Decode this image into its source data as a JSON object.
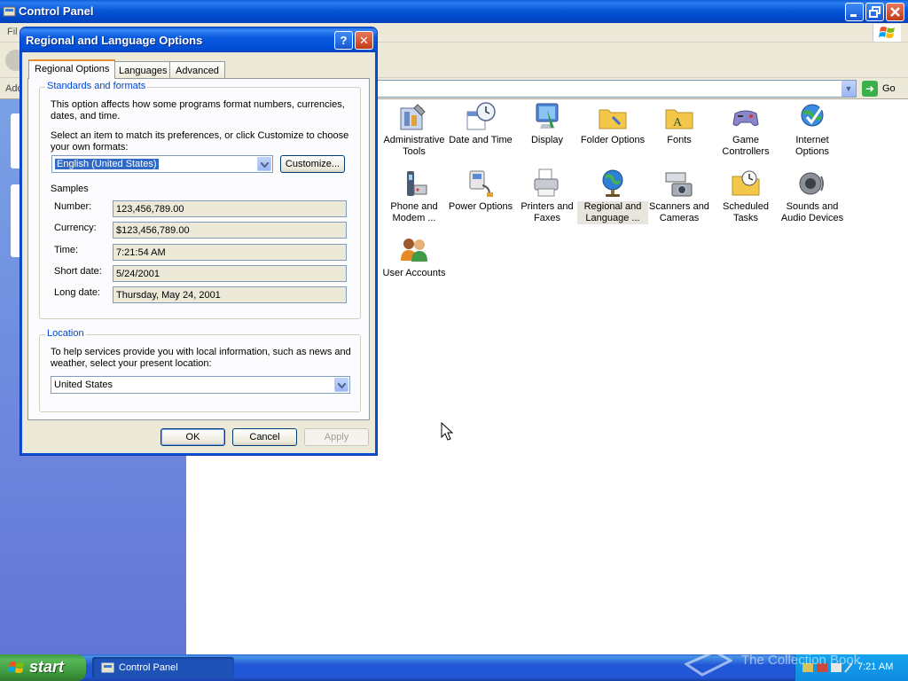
{
  "cp_window": {
    "title": "Control Panel",
    "menu_file": "Fil",
    "address_label": "Add",
    "go_label": "Go",
    "items": [
      {
        "id": "administrative-tools",
        "label": "Administrative Tools",
        "icon": "admin-tools-icon"
      },
      {
        "id": "date-and-time",
        "label": "Date and Time",
        "icon": "clock-calendar-icon"
      },
      {
        "id": "display",
        "label": "Display",
        "icon": "monitor-icon"
      },
      {
        "id": "folder-options",
        "label": "Folder Options",
        "icon": "folder-icon"
      },
      {
        "id": "fonts",
        "label": "Fonts",
        "icon": "fonts-folder-icon"
      },
      {
        "id": "game-controllers",
        "label": "Game Controllers",
        "icon": "gamepad-icon"
      },
      {
        "id": "internet-options",
        "label": "Internet Options",
        "icon": "globe-check-icon"
      },
      {
        "id": "phone-and-modem",
        "label": "Phone and Modem ...",
        "icon": "phone-icon"
      },
      {
        "id": "power-options",
        "label": "Power Options",
        "icon": "power-plug-icon"
      },
      {
        "id": "printers-and-faxes",
        "label": "Printers and Faxes",
        "icon": "printer-icon"
      },
      {
        "id": "regional-and-language",
        "label": "Regional and Language ...",
        "icon": "globe-icon",
        "selected": true
      },
      {
        "id": "scanners-and-cameras",
        "label": "Scanners and Cameras",
        "icon": "scanner-camera-icon"
      },
      {
        "id": "scheduled-tasks",
        "label": "Scheduled Tasks",
        "icon": "scheduled-folder-icon"
      },
      {
        "id": "sounds-and-audio",
        "label": "Sounds and Audio Devices",
        "icon": "speaker-icon"
      },
      {
        "id": "user-accounts",
        "label": "User Accounts",
        "icon": "users-icon"
      }
    ]
  },
  "dialog": {
    "title": "Regional and Language Options",
    "help_glyph": "?",
    "close_glyph": "✕",
    "tabs": [
      {
        "label": "Regional Options",
        "active": true
      },
      {
        "label": "Languages"
      },
      {
        "label": "Advanced"
      }
    ],
    "standards": {
      "legend": "Standards and formats",
      "desc": "This option affects how some programs format numbers, currencies, dates, and time.",
      "select_text": "Select an item to match its preferences, or click Customize to choose your own formats:",
      "format_value": "English (United States)",
      "customize_label": "Customize...",
      "samples_label": "Samples",
      "samples": [
        {
          "label": "Number:",
          "value": "123,456,789.00"
        },
        {
          "label": "Currency:",
          "value": "$123,456,789.00"
        },
        {
          "label": "Time:",
          "value": "7:21:54 AM"
        },
        {
          "label": "Short date:",
          "value": "5/24/2001"
        },
        {
          "label": "Long date:",
          "value": "Thursday, May 24, 2001"
        }
      ]
    },
    "location": {
      "legend": "Location",
      "desc": "To help services provide you with local information, such as news and weather, select your present location:",
      "value": "United States"
    },
    "buttons": {
      "ok": "OK",
      "cancel": "Cancel",
      "apply": "Apply"
    }
  },
  "taskbar": {
    "start_label": "start",
    "task_label": "Control Panel",
    "clock": "7:21 AM"
  },
  "watermark": "The Collection Book",
  "colors": {
    "xp_blue": "#0054e3",
    "start_green": "#3c9b3c",
    "legend_blue": "#0046d5"
  }
}
